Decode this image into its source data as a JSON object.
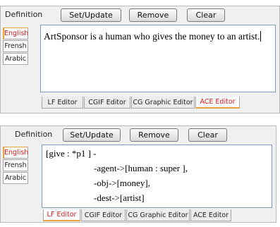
{
  "panel1": {
    "toolbar": {
      "definition_label": "Definition",
      "set_update": "Set/Update",
      "remove": "Remove",
      "clear": "Clear"
    },
    "languages": [
      {
        "label": "English",
        "active": true
      },
      {
        "label": "Frensh",
        "active": false
      },
      {
        "label": "Arabic",
        "active": false
      }
    ],
    "content_text": "ArtSponsor is a human who gives the money to an artist.",
    "tabs": [
      {
        "label": "LF Editor",
        "active": false
      },
      {
        "label": "CGIF Editor",
        "active": false
      },
      {
        "label": "CG Graphic Editor",
        "active": false
      },
      {
        "label": "ACE Editor",
        "active": true
      }
    ]
  },
  "panel2": {
    "toolbar": {
      "definition_label": "Definition",
      "set_update": "Set/Update",
      "remove": "Remove",
      "clear": "Clear"
    },
    "languages": [
      {
        "label": "English",
        "active": true
      },
      {
        "label": "Frensh",
        "active": false
      },
      {
        "label": "Arabic",
        "active": false
      }
    ],
    "cg_lines": [
      "[give : *p1 ] -",
      "-agent->[human : super ],",
      "-obj->[money],",
      "-dest->[artist]"
    ],
    "tabs": [
      {
        "label": "LF Editor",
        "active": true
      },
      {
        "label": "CGIF Editor",
        "active": false
      },
      {
        "label": "CG Graphic Editor",
        "active": false
      },
      {
        "label": "ACE Editor",
        "active": false
      }
    ]
  },
  "colors": {
    "active_text": "#d31b1b",
    "active_accent": "#e8a33a",
    "panel_bg": "#f0f0f0"
  }
}
